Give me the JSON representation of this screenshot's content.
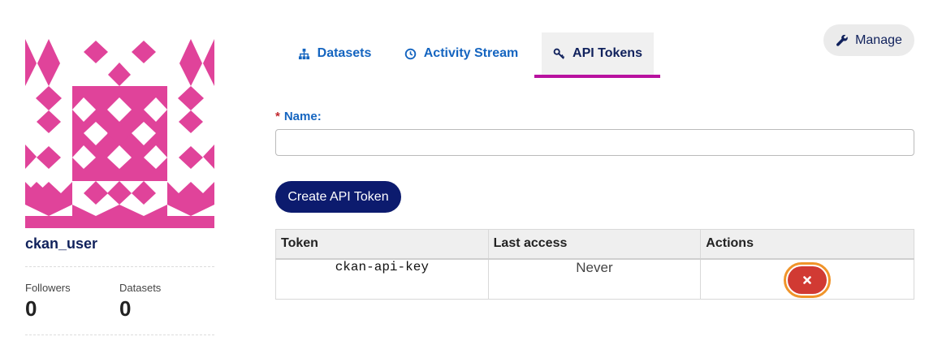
{
  "user": {
    "username": "ckan_user",
    "avatar_color": "#e0439a",
    "stats": [
      {
        "label": "Followers",
        "value": "0"
      },
      {
        "label": "Datasets",
        "value": "0"
      }
    ]
  },
  "header": {
    "manage_label": "Manage",
    "manage_icon": "wrench-icon"
  },
  "tabs": [
    {
      "label": "Datasets",
      "icon": "sitemap-icon",
      "active": false
    },
    {
      "label": "Activity Stream",
      "icon": "clock-icon",
      "active": false
    },
    {
      "label": "API Tokens",
      "icon": "key-icon",
      "active": true
    }
  ],
  "form": {
    "required_marker": "*",
    "name_label": "Name:",
    "name_value": "",
    "create_button_label": "Create API Token"
  },
  "table": {
    "columns": [
      "Token",
      "Last access",
      "Actions"
    ],
    "rows": [
      {
        "token": "ckan-api-key",
        "last_access": "Never",
        "action": "revoke"
      }
    ]
  },
  "colors": {
    "brand_dark": "#10215c",
    "link_blue": "#1565c0",
    "tab_underline": "#b8129f",
    "revoke_red": "#d13a33",
    "focus_ring": "#f0942a"
  }
}
